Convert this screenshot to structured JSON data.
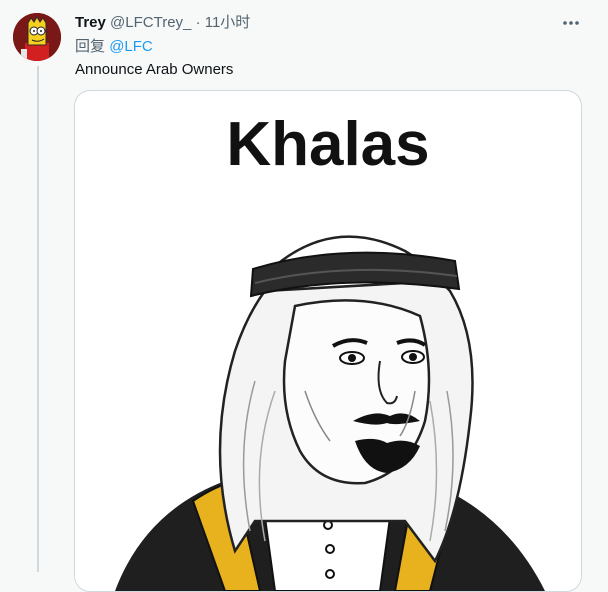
{
  "tweet": {
    "author_name": "Trey",
    "handle": "@LFCTrey_",
    "separator": "·",
    "time": "11小时",
    "reply_label": "回复",
    "reply_mention": "@LFC",
    "text": "Announce Arab Owners"
  },
  "media": {
    "caption": "Khalas"
  },
  "icons": {
    "avatar": "simpson-character-avatar",
    "more": "more-dots-icon"
  },
  "colors": {
    "link": "#1d9bf0",
    "muted": "#536471",
    "thread_line": "#cfd9de",
    "headband": "#2b2b2b",
    "robe_trim": "#e8b21e"
  }
}
